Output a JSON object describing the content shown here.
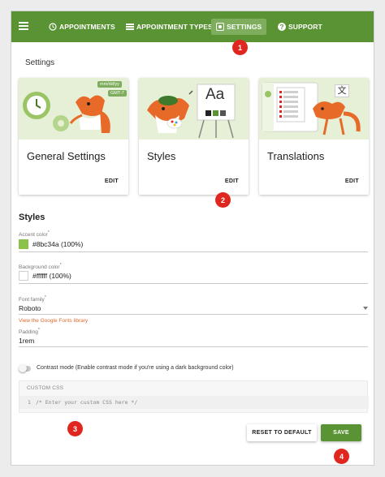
{
  "colors": {
    "accent": "#5a9334",
    "nav_active": "#7eae5d",
    "badge": "#e0271f",
    "link": "#e06a2e",
    "swatch_accent": "#8bc34a",
    "swatch_background": "#ffffff"
  },
  "nav": {
    "items": [
      {
        "label": "APPOINTMENTS",
        "icon": "clock-icon"
      },
      {
        "label": "APPOINTMENT TYPES",
        "icon": "list-icon"
      },
      {
        "label": "SETTINGS",
        "icon": "settings-icon",
        "active": true
      },
      {
        "label": "SUPPORT",
        "icon": "help-icon"
      }
    ]
  },
  "badges": [
    "1",
    "2",
    "3",
    "4"
  ],
  "page_title": "Settings",
  "cards": [
    {
      "title": "General Settings",
      "edit": "EDIT",
      "illustration_text": [
        "mm/dd/yy",
        "GMT-7"
      ]
    },
    {
      "title": "Styles",
      "edit": "EDIT",
      "illustration_text": [
        "Aa"
      ]
    },
    {
      "title": "Translations",
      "edit": "EDIT",
      "illustration_text": [
        "文"
      ]
    }
  ],
  "styles": {
    "title": "Styles",
    "accent_color": {
      "label": "Accent color",
      "required_mark": "*",
      "value": "#8bc34a (100%)"
    },
    "background_color": {
      "label": "Background color",
      "required_mark": "*",
      "value": "#ffffff (100%)"
    },
    "font_family": {
      "label": "Font family",
      "required_mark": "*",
      "value": "Roboto",
      "link": "View the Google Fonts library"
    },
    "padding": {
      "label": "Padding",
      "required_mark": "*",
      "value": "1rem"
    },
    "contrast_mode": {
      "label": "Contrast mode (Enable contrast mode if you're using a dark background color)",
      "enabled": false
    },
    "custom_css": {
      "label": "CUSTOM CSS",
      "line_number": "1",
      "placeholder": "/* Enter your custom CSS here */"
    }
  },
  "buttons": {
    "reset": "RESET TO DEFAULT",
    "save": "SAVE"
  }
}
